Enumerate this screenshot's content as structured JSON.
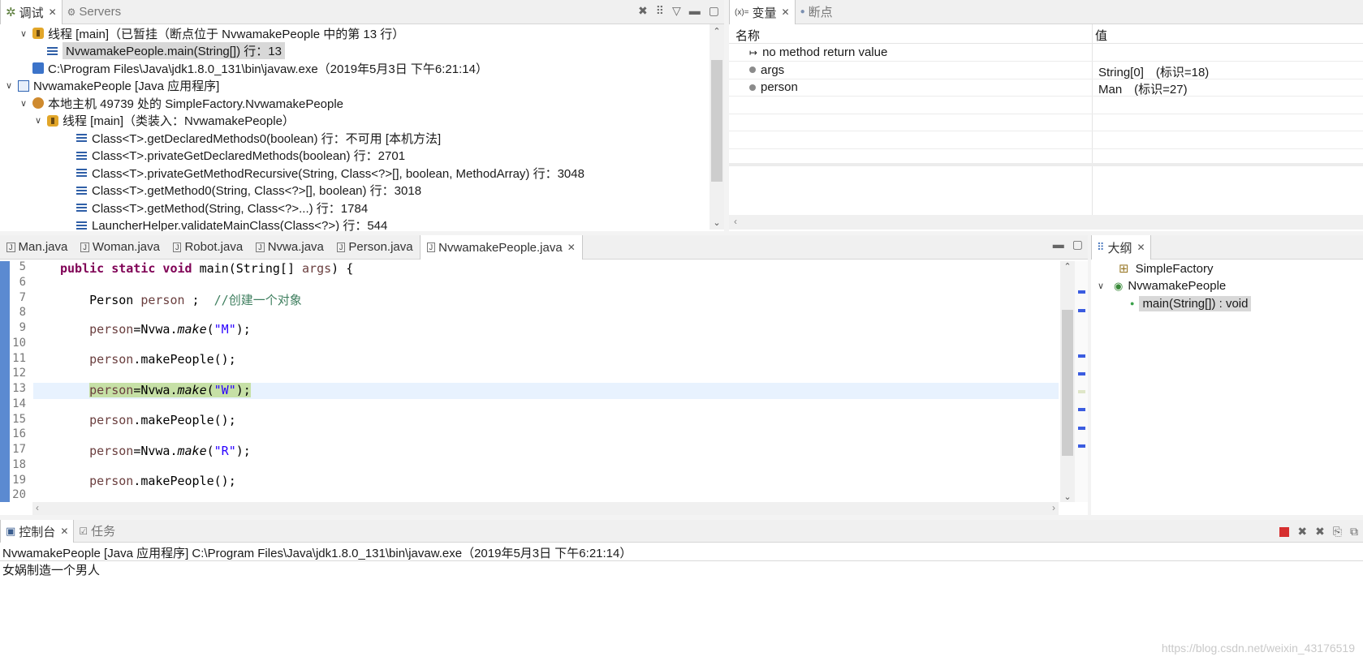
{
  "debug_view": {
    "tabs": [
      {
        "label": "调试",
        "active": true
      },
      {
        "label": "Servers",
        "active": false
      }
    ],
    "tree": [
      {
        "indent": 1,
        "toggle": "∨",
        "icon": "thread",
        "text": "线程 [main]（已暂挂（断点位于 NvwamakePeople 中的第 13 行）"
      },
      {
        "indent": 2,
        "toggle": "",
        "icon": "stack",
        "text": "NvwamakePeople.main(String[]) 行：13",
        "selected": true
      },
      {
        "indent": 1,
        "toggle": "",
        "icon": "proc",
        "text": "C:\\Program Files\\Java\\jdk1.8.0_131\\bin\\javaw.exe（2019年5月3日 下午6:21:14）"
      },
      {
        "indent": 0,
        "toggle": "∨",
        "icon": "app",
        "text": "NvwamakePeople [Java 应用程序]"
      },
      {
        "indent": 1,
        "toggle": "∨",
        "icon": "host",
        "text": "本地主机 49739 处的 SimpleFactory.NvwamakePeople"
      },
      {
        "indent": 2,
        "toggle": "∨",
        "icon": "thread",
        "text": "线程 [main]（类装入：NvwamakePeople）"
      },
      {
        "indent": 3,
        "toggle": "",
        "icon": "stack",
        "text": "Class<T>.getDeclaredMethods0(boolean) 行：不可用 [本机方法]"
      },
      {
        "indent": 3,
        "toggle": "",
        "icon": "stack",
        "text": "Class<T>.privateGetDeclaredMethods(boolean) 行：2701"
      },
      {
        "indent": 3,
        "toggle": "",
        "icon": "stack",
        "text": "Class<T>.privateGetMethodRecursive(String, Class<?>[], boolean, MethodArray) 行：3048"
      },
      {
        "indent": 3,
        "toggle": "",
        "icon": "stack",
        "text": "Class<T>.getMethod0(String, Class<?>[], boolean) 行：3018"
      },
      {
        "indent": 3,
        "toggle": "",
        "icon": "stack",
        "text": "Class<T>.getMethod(String, Class<?>...) 行：1784"
      },
      {
        "indent": 3,
        "toggle": "",
        "icon": "stack",
        "text": "LauncherHelper.validateMainClass(Class<?>) 行：544"
      }
    ]
  },
  "variables_view": {
    "tabs": [
      {
        "label": "变量",
        "active": true
      },
      {
        "label": "断点",
        "active": false
      }
    ],
    "tab_prefix": "(x)=",
    "col_name": "名称",
    "col_value": "值",
    "rows": [
      {
        "name": "no method return value",
        "value": "",
        "icon": "return"
      },
      {
        "name": "args",
        "value": "String[0]　(标识=18)",
        "icon": "dot"
      },
      {
        "name": "person",
        "value": "Man　(标识=27)",
        "icon": "dot"
      }
    ]
  },
  "editor": {
    "tabs": [
      {
        "label": "Man.java",
        "active": false
      },
      {
        "label": "Woman.java",
        "active": false
      },
      {
        "label": "Robot.java",
        "active": false
      },
      {
        "label": "Nvwa.java",
        "active": false
      },
      {
        "label": "Person.java",
        "active": false
      },
      {
        "label": "NvwamakePeople.java",
        "active": true
      }
    ],
    "line_numbers": [
      "5",
      "6",
      "7",
      "8",
      "9",
      "10",
      "11",
      "12",
      "13",
      "14",
      "15",
      "16",
      "17",
      "18",
      "19",
      "20"
    ],
    "code": {
      "l5_kw": "public static void ",
      "l5_rest": "main(String[] ",
      "l5_var": "args",
      "l5_end": ") {",
      "l7_type": "Person ",
      "l7_var": "person",
      "l7_mid": " ;  ",
      "l7_cm": "//创建一个对象",
      "make": "make",
      "assign_prefix": "=Nvwa.",
      "s_m": "\"M\"",
      "s_w": "\"W\"",
      "s_r": "\"R\"",
      "open": "(",
      "close": ");",
      "var": "person",
      "make_people": ".makePeople();"
    },
    "current_line": "13"
  },
  "outline_view": {
    "tab_label": "大纲",
    "items": [
      {
        "label": "SimpleFactory",
        "indent": 1,
        "toggle": ""
      },
      {
        "label": "NvwamakePeople",
        "indent": 0,
        "toggle": "∨"
      },
      {
        "label": "main(String[]) : void",
        "indent": 2,
        "toggle": "",
        "selected": true
      }
    ]
  },
  "console_view": {
    "tabs": [
      {
        "label": "控制台",
        "active": true
      },
      {
        "label": "任务",
        "active": false
      }
    ],
    "header": "NvwamakePeople [Java 应用程序] C:\\Program Files\\Java\\jdk1.8.0_131\\bin\\javaw.exe（2019年5月3日 下午6:21:14）",
    "output": "女娲制造一个男人",
    "watermark": "https://blog.csdn.net/weixin_43176519"
  },
  "colors": {
    "keyword": "#7f0055",
    "comment": "#3f7f5f",
    "string": "#2a00ff",
    "local_var": "#6a3e3e",
    "current_line": "#e8f2fe",
    "highlight": "#c6e0a6",
    "terminate": "#d62f2f"
  }
}
